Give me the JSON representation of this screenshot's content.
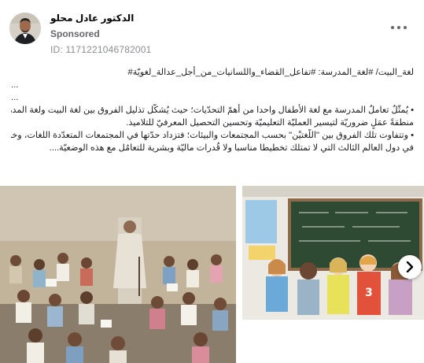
{
  "post": {
    "author": "الدكتور عادل محلو",
    "sponsored_label": "Sponsored",
    "ad_id": "ID: 1171221046782001"
  },
  "body": {
    "hashtags": "لغة_البيت/ #لغة_المدرسة: #تفاعل_القضاء_واللسانيات_من_أجل_عدالة_لغويّة#",
    "ellipsis1": "...",
    "ellipsis2": "...",
    "line1": "• يُمثّلُ تعاملُ المدرسة مع لغة الأطفال واحدا من أهمّ التحدّيات؛ حيث يُشكّل تذليل الفروق بين لغة البيت ولغة المدرسة",
    "line2": "منطقةً عمَلٍ ضروريّة لتيسير العمليّة التعليميّة وتحسين التحصيل المعرفيّ للتلاميذ.",
    "line3": "• وتتفاوت تلك الفروق بين \"اللُّغتيْن\" بحسب المجتمعات والبيئات؛ فتزداد حدّتها في المجتمعات المتعدّدة اللغات، وخاصة",
    "line4": "في دول العالم الثالث التي لا تمتلك تخطيطا مناسبا ولا قُدرات ماليّة وبشرية للتعامُل مع هذه الوضعيّة...."
  },
  "icons": {
    "menu": "more-horizontal-icon",
    "next": "chevron-right-icon"
  },
  "colors": {
    "text": "#1c1e21",
    "secondary": "#65676b",
    "muted": "#8a8d91",
    "chalkboard": "#2f4a33"
  }
}
